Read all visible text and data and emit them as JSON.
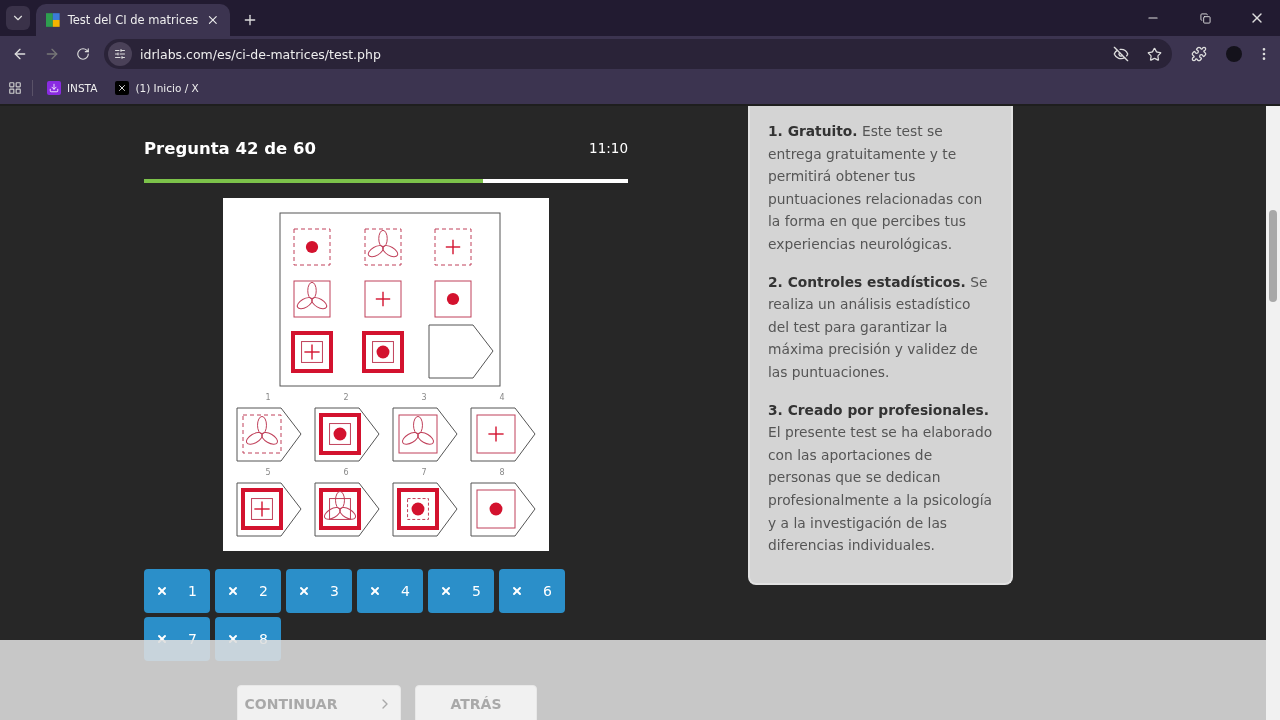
{
  "browser": {
    "tab_title": "Test del CI de matrices",
    "url": "idrlabs.com/es/ci-de-matrices/test.php",
    "bookmarks": [
      {
        "label": "INSTA",
        "kind": "download"
      },
      {
        "label": "(1) Inicio / X",
        "kind": "x"
      }
    ]
  },
  "question": {
    "title": "Pregunta 42 de 60",
    "timer": "11:10",
    "progress": {
      "level": 0.7
    }
  },
  "puzzle": {
    "options": [
      {
        "number": "1"
      },
      {
        "number": "2"
      },
      {
        "number": "3"
      },
      {
        "number": "4"
      },
      {
        "number": "5"
      },
      {
        "number": "6"
      },
      {
        "number": "7"
      },
      {
        "number": "8"
      }
    ]
  },
  "answers": [
    {
      "label": "1"
    },
    {
      "label": "2"
    },
    {
      "label": "3"
    },
    {
      "label": "4"
    },
    {
      "label": "5"
    },
    {
      "label": "6"
    },
    {
      "label": "7"
    },
    {
      "label": "8"
    }
  ],
  "info": [
    {
      "heading": "1. Gratuito.",
      "text": "Este test se entrega gratuitamente y te permitirá obtener tus puntuaciones relacionadas con la forma en que percibes tus experiencias neurológicas."
    },
    {
      "heading": "2. Controles estadísticos.",
      "text": "Se realiza un análisis estadístico del test para garantizar la máxima precisión y validez de las puntuaciones."
    },
    {
      "heading": "3. Creado por profesionales.",
      "text": "El presente test se ha elaborado con las aportaciones de personas que se dedican profesionalmente a la psicología y a la investigación de las diferencias individuales."
    }
  ],
  "footer": {
    "continue": {
      "label": "CONTINUAR",
      "disabled": true
    },
    "back": {
      "label": "ATRÁS",
      "disabled": true
    }
  }
}
